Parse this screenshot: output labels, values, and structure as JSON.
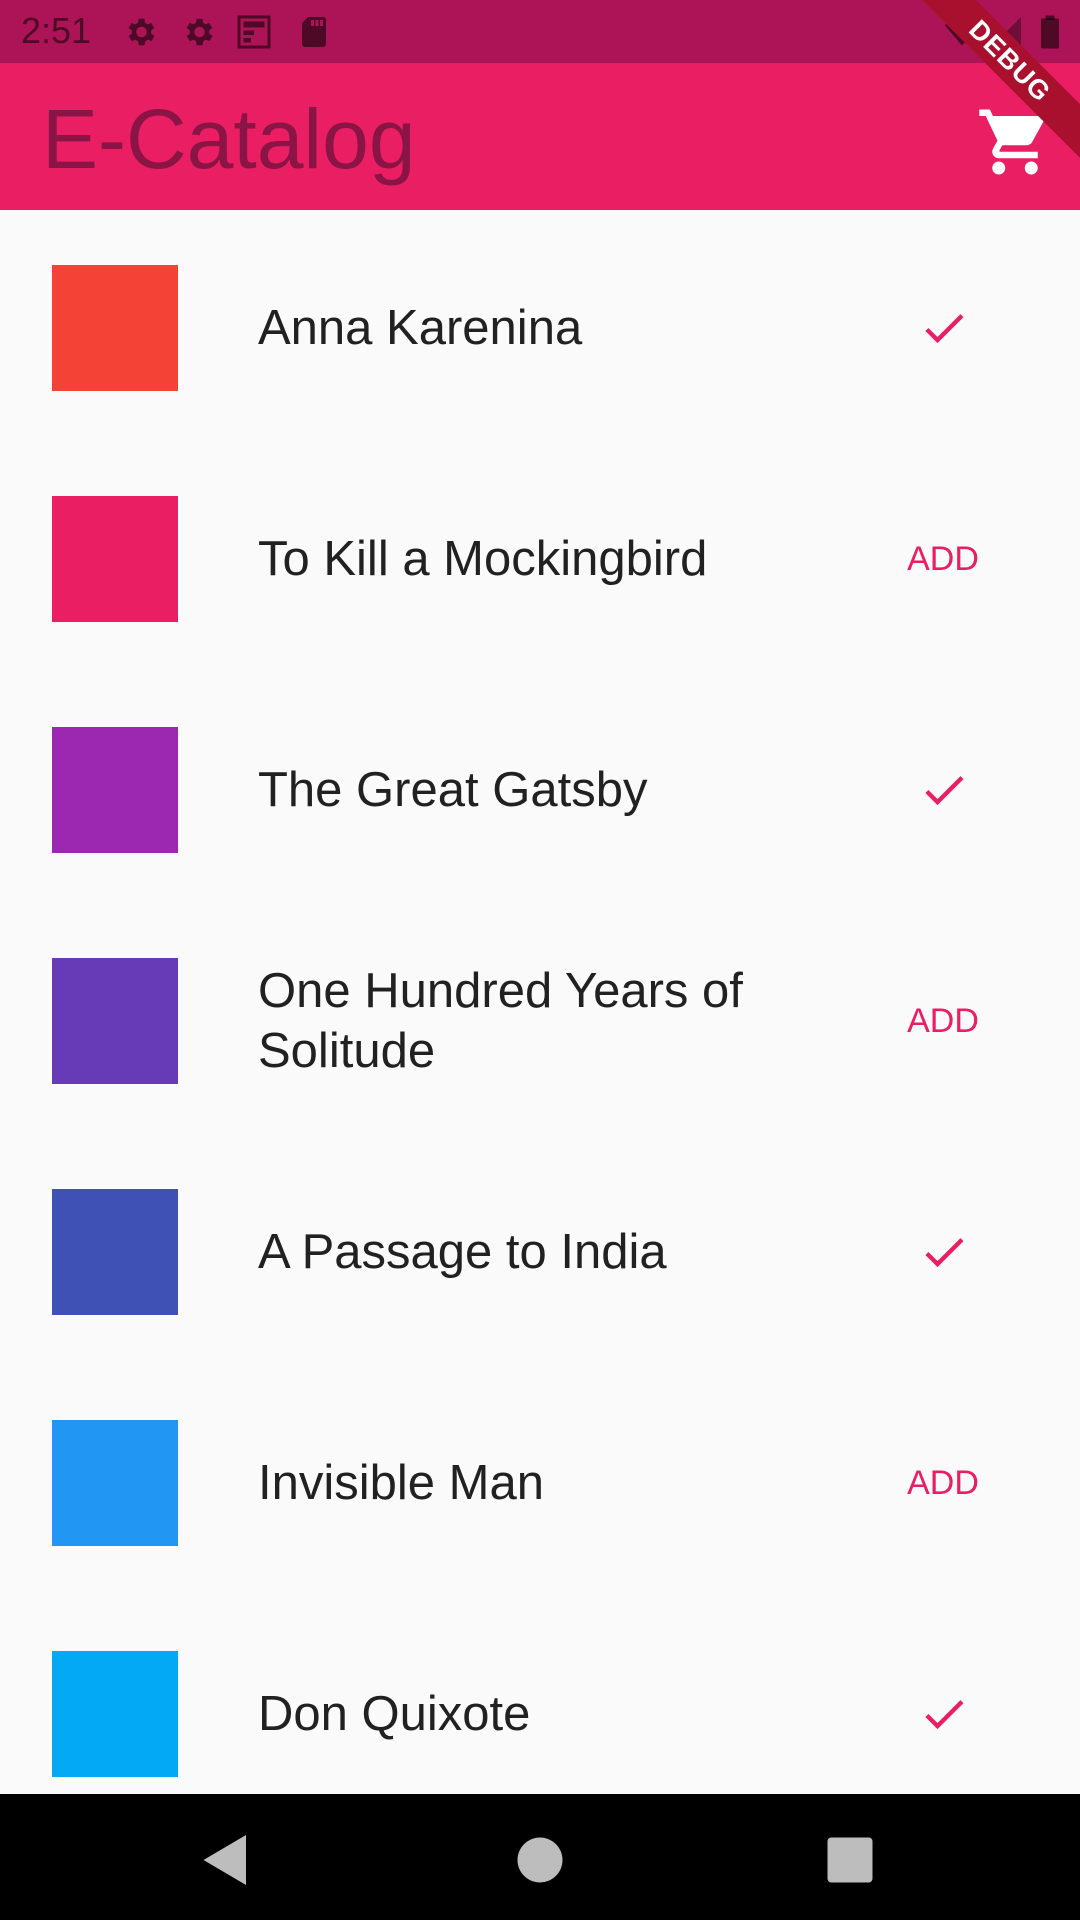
{
  "status_bar": {
    "time": "2:51",
    "icons": [
      "gear-icon",
      "gear-icon",
      "screenshot-icon",
      "sd-card-icon"
    ],
    "right_icons": [
      "wifi-icon",
      "signal-icon",
      "battery-icon"
    ],
    "color": "#ad1457"
  },
  "app_bar": {
    "title": "E-Catalog",
    "cart_icon": "shopping-cart-icon",
    "color": "#e91e63"
  },
  "debug_banner": {
    "label": "DEBUG"
  },
  "catalog": {
    "items": [
      {
        "title": "Anna Karenina",
        "color": "#f44336",
        "in_cart": true
      },
      {
        "title": "To Kill a Mockingbird",
        "color": "#e91e63",
        "in_cart": false
      },
      {
        "title": "The Great Gatsby",
        "color": "#9c27b0",
        "in_cart": true
      },
      {
        "title": "One Hundred Years of Solitude",
        "color": "#673ab7",
        "in_cart": false
      },
      {
        "title": "A Passage to India",
        "color": "#3f51b5",
        "in_cart": true
      },
      {
        "title": "Invisible Man",
        "color": "#2196f3",
        "in_cart": false
      },
      {
        "title": "Don Quixote",
        "color": "#03a9f4",
        "in_cart": true
      }
    ],
    "add_label": "ADD",
    "accent": "#e91e63"
  },
  "nav_bar": {
    "icons": [
      "back-icon",
      "home-icon",
      "recents-icon"
    ]
  }
}
